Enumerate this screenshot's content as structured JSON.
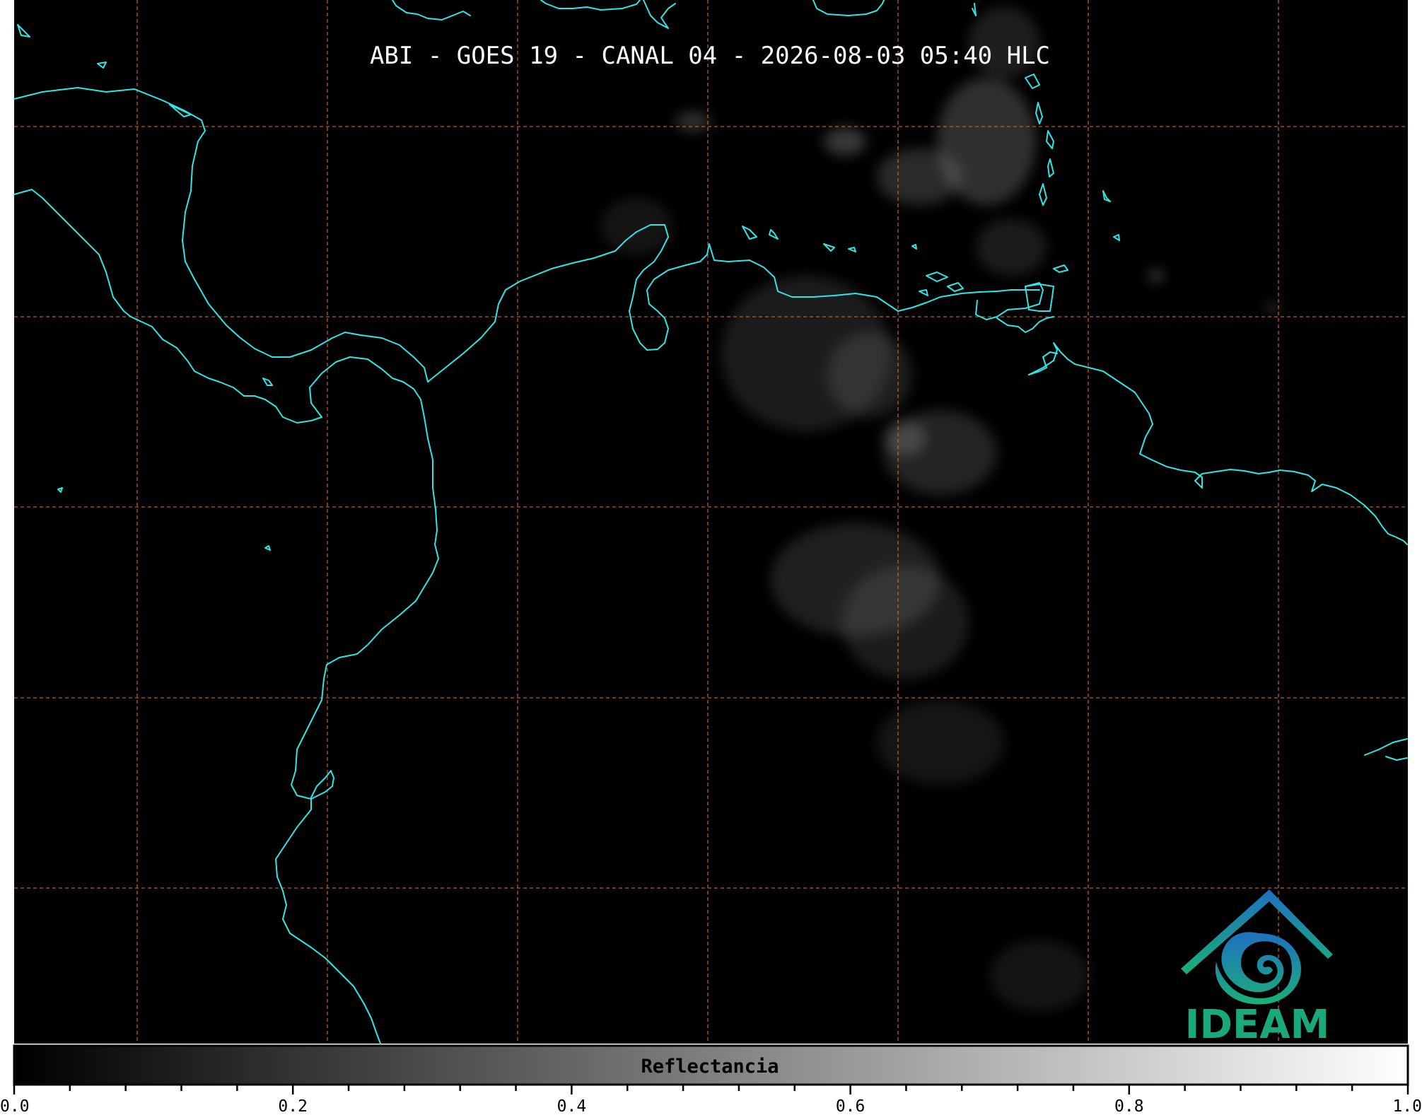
{
  "title": "ABI - GOES 19 - CANAL 04 - 2026-08-03 05:40 HLC",
  "colors": {
    "background": "#000000",
    "coastline": "#2ee6e6",
    "gridlines": "#d2691e",
    "colorbar_low": "#000000",
    "colorbar_high": "#ffffff",
    "logo_blue": "#1f7fc0",
    "logo_green": "#1aa97c"
  },
  "colorbar": {
    "label": "Reflectancia",
    "min": 0.0,
    "max": 1.0,
    "tick_labels": [
      "0.0",
      "0.2",
      "0.4",
      "0.6",
      "0.8",
      "1.0"
    ],
    "tick_values": [
      0.0,
      0.2,
      0.4,
      0.6,
      0.8,
      1.0
    ],
    "minor_ticks_per_major": 4
  },
  "map": {
    "gridline_style": "dashed",
    "icons": [
      "coastline-outlines",
      "cloud-field"
    ]
  },
  "logo": {
    "text": "IDEAM",
    "icon": "ideam-spiral-logo-icon"
  }
}
